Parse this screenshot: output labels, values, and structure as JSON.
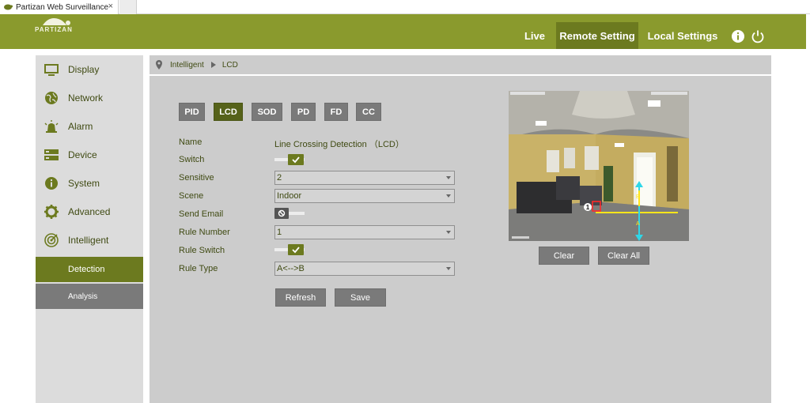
{
  "browser": {
    "tab_title": "Partizan Web Surveillance",
    "tab_close": "×"
  },
  "header": {
    "logo_text": "PARTIZAN",
    "nav": {
      "live": "Live",
      "remote_setting": "Remote Setting",
      "local_settings": "Local Settings"
    },
    "icons": [
      "info-icon",
      "power-icon"
    ],
    "colors": {
      "brand": "#8a9a2d",
      "active_nav": "#6c7a1f"
    }
  },
  "sidebar": {
    "items": [
      {
        "label": "Display",
        "icon": "monitor-icon"
      },
      {
        "label": "Network",
        "icon": "globe-icon"
      },
      {
        "label": "Alarm",
        "icon": "alarm-icon"
      },
      {
        "label": "Device",
        "icon": "device-icon"
      },
      {
        "label": "System",
        "icon": "info-circle-icon"
      },
      {
        "label": "Advanced",
        "icon": "gear-icon"
      },
      {
        "label": "Intelligent",
        "icon": "target-icon"
      }
    ],
    "sub_items": [
      {
        "label": "Detection",
        "active": true
      },
      {
        "label": "Analysis",
        "active": false
      }
    ]
  },
  "breadcrumb": {
    "section": "Intelligent",
    "page": "LCD"
  },
  "type_tabs": [
    {
      "label": "PID",
      "active": false
    },
    {
      "label": "LCD",
      "active": true
    },
    {
      "label": "SOD",
      "active": false
    },
    {
      "label": "PD",
      "active": false
    },
    {
      "label": "FD",
      "active": false
    },
    {
      "label": "CC",
      "active": false
    }
  ],
  "form": {
    "name": {
      "label": "Name",
      "value": "Line Crossing Detection （LCD）"
    },
    "switch": {
      "label": "Switch",
      "on": true
    },
    "sensitive": {
      "label": "Sensitive",
      "value": "2"
    },
    "scene": {
      "label": "Scene",
      "value": "Indoor"
    },
    "send_email": {
      "label": "Send Email",
      "on": false
    },
    "rule_number": {
      "label": "Rule Number",
      "value": "1"
    },
    "rule_switch": {
      "label": "Rule Switch",
      "on": true
    },
    "rule_type": {
      "label": "Rule Type",
      "value": "A<-->B"
    }
  },
  "buttons": {
    "refresh": "Refresh",
    "save": "Save",
    "clear": "Clear",
    "clear_all": "Clear All"
  },
  "preview": {
    "rule_marker": "1",
    "point_a": "A",
    "point_b": "B"
  }
}
